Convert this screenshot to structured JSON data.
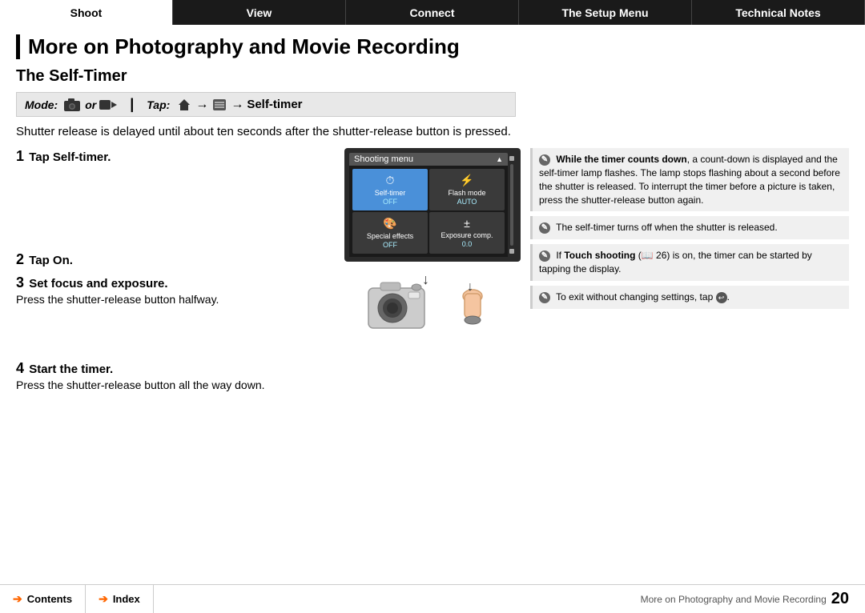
{
  "nav": {
    "items": [
      {
        "label": "Shoot",
        "active": true
      },
      {
        "label": "View",
        "active": false
      },
      {
        "label": "Connect",
        "active": false
      },
      {
        "label": "The Setup Menu",
        "active": false
      },
      {
        "label": "Technical Notes",
        "active": false
      }
    ]
  },
  "page": {
    "title": "More on Photography and Movie Recording",
    "section": "The Self-Timer",
    "mode_label": "Mode:",
    "mode_or": "or",
    "tap_label": "Tap:",
    "self_timer_label": "Self-timer",
    "intro": "Shutter release is delayed until about ten seconds after the shutter-release button is pressed.",
    "steps": [
      {
        "num": "1",
        "label": "Tap Self-timer."
      },
      {
        "num": "2",
        "label": "Tap On."
      },
      {
        "num": "3",
        "label": "Set focus and exposure.",
        "sub": "Press the shutter-release button halfway."
      },
      {
        "num": "4",
        "label": "Start the timer.",
        "sub": "Press the shutter-release button all the way down."
      }
    ],
    "screen": {
      "title": "Shooting menu",
      "cells": [
        {
          "icon": "⏱",
          "label": "Self-timer",
          "highlighted": true
        },
        {
          "icon": "⚡",
          "label": "Flash mode",
          "highlighted": false
        },
        {
          "icon": "🎨",
          "label": "Special effects",
          "highlighted": false
        },
        {
          "icon": "±",
          "label": "Exposure comp.",
          "highlighted": false
        }
      ]
    },
    "notes": [
      {
        "bold_start": "While the timer counts down",
        "text": ", a count-down is displayed and the self-timer lamp flashes. The lamp stops flashing about a second before the shutter is released. To interrupt the timer before a picture is taken, press the shutter-release button again."
      },
      {
        "bold_start": "",
        "text": "The self-timer turns off when the shutter is released."
      },
      {
        "bold_start": "Touch shooting",
        "text": " is on, the timer can be started by tapping the display.",
        "prefix": "If "
      },
      {
        "bold_start": "",
        "text": "To exit without changing settings, tap "
      }
    ]
  },
  "footer": {
    "contents_label": "Contents",
    "index_label": "Index",
    "page_context": "More on Photography and Movie Recording",
    "page_number": "20"
  }
}
